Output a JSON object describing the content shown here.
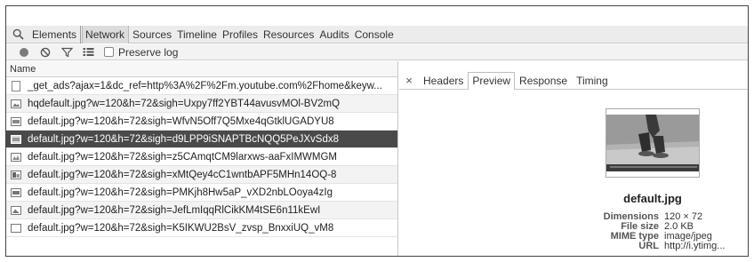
{
  "tabs": [
    {
      "label": "Elements"
    },
    {
      "label": "Network",
      "active": true
    },
    {
      "label": "Sources"
    },
    {
      "label": "Timeline"
    },
    {
      "label": "Profiles"
    },
    {
      "label": "Resources"
    },
    {
      "label": "Audits"
    },
    {
      "label": "Console"
    }
  ],
  "toolbar": {
    "preserve_log_label": "Preserve log",
    "preserve_log_checked": false
  },
  "request_list": {
    "column_header": "Name",
    "rows": [
      {
        "name": "_get_ads?ajax=1&dc_ref=http%3A%2F%2Fm.youtube.com%2Fhome&keyw..."
      },
      {
        "name": "hqdefault.jpg?w=120&h=72&sigh=Uxpy7ff2YBT44avusvMOl-BV2mQ"
      },
      {
        "name": "default.jpg?w=120&h=72&sigh=WfvN5Off7Q5Mxe4qGtklUGADYU8"
      },
      {
        "name": "default.jpg?w=120&h=72&sigh=d9LPP9iSNAPTBcNQQ5PeJXvSdx8",
        "selected": true
      },
      {
        "name": "default.jpg?w=120&h=72&sigh=z5CAmqtCM9larxws-aaFxIMWMGM"
      },
      {
        "name": "default.jpg?w=120&h=72&sigh=xMtQey4cC1wntbAPF5MHn14OQ-8"
      },
      {
        "name": "default.jpg?w=120&h=72&sigh=PMKjh8Hw5aP_vXD2nbLOoya4zIg"
      },
      {
        "name": "default.jpg?w=120&h=72&sigh=JefLmIqqRlCikKM4tSE6n11kEwI"
      },
      {
        "name": "default.jpg?w=120&h=72&sigh=K5IKWU2BsV_zvsp_BnxxiUQ_vM8"
      }
    ]
  },
  "detail": {
    "close_icon": "close-icon",
    "tabs": [
      {
        "label": "Headers"
      },
      {
        "label": "Preview",
        "active": true
      },
      {
        "label": "Response"
      },
      {
        "label": "Timing"
      }
    ],
    "filename": "default.jpg",
    "meta": [
      {
        "key": "Dimensions",
        "value": "120 × 72"
      },
      {
        "key": "File size",
        "value": "2.0 KB"
      },
      {
        "key": "MIME type",
        "value": "image/jpeg"
      },
      {
        "key": "URL",
        "value": "http://i.ytimg..."
      }
    ]
  },
  "colors": {
    "selected_row": "#4a4a4a",
    "record_dot": "#7a7a7a"
  }
}
